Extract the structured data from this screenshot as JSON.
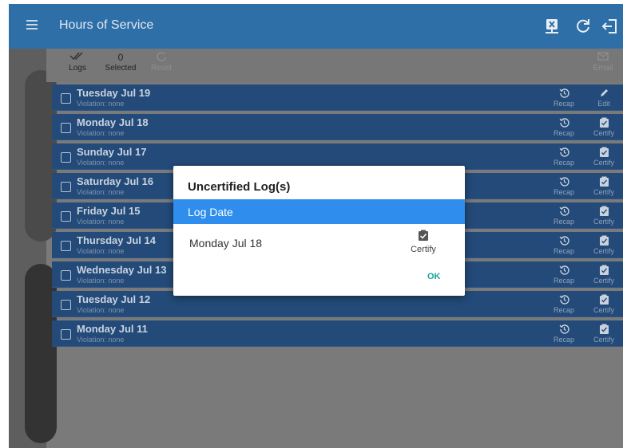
{
  "app": {
    "title": "Hours of Service"
  },
  "toolbar": {
    "logs_label": "Logs",
    "selected_count": "0",
    "selected_label": "Selected",
    "reset_label": "Reset",
    "email_label": "Email"
  },
  "logs": [
    {
      "date": "Tuesday Jul 19",
      "violation": "Violation: none",
      "recap": "Recap",
      "action": "Edit",
      "action_icon": "pencil-icon"
    },
    {
      "date": "Monday Jul 18",
      "violation": "Violation: none",
      "recap": "Recap",
      "action": "Certify",
      "action_icon": "clipboard-check-icon"
    },
    {
      "date": "Sunday Jul 17",
      "violation": "Violation: none",
      "recap": "Recap",
      "action": "Certify",
      "action_icon": "clipboard-check-icon"
    },
    {
      "date": "Saturday Jul 16",
      "violation": "Violation: none",
      "recap": "Recap",
      "action": "Certify",
      "action_icon": "clipboard-check-icon"
    },
    {
      "date": "Friday Jul 15",
      "violation": "Violation: none",
      "recap": "Recap",
      "action": "Certify",
      "action_icon": "clipboard-check-icon"
    },
    {
      "date": "Thursday Jul 14",
      "violation": "Violation: none",
      "recap": "Recap",
      "action": "Certify",
      "action_icon": "clipboard-check-icon"
    },
    {
      "date": "Wednesday Jul 13",
      "violation": "Violation: none",
      "recap": "Recap",
      "action": "Certify",
      "action_icon": "clipboard-check-icon"
    },
    {
      "date": "Tuesday Jul 12",
      "violation": "Violation: none",
      "recap": "Recap",
      "action": "Certify",
      "action_icon": "clipboard-check-icon"
    },
    {
      "date": "Monday Jul 11",
      "violation": "Violation: none",
      "recap": "Recap",
      "action": "Certify",
      "action_icon": "clipboard-check-icon"
    }
  ],
  "dialog": {
    "title": "Uncertified Log(s)",
    "column_header": "Log Date",
    "row_date": "Monday Jul 18",
    "certify_label": "Certify",
    "ok_label": "OK"
  },
  "colors": {
    "appbar": "#2f6fa8",
    "row": "#234a79",
    "dialog_header": "#2e8ded",
    "ok_accent": "#15a39b"
  }
}
